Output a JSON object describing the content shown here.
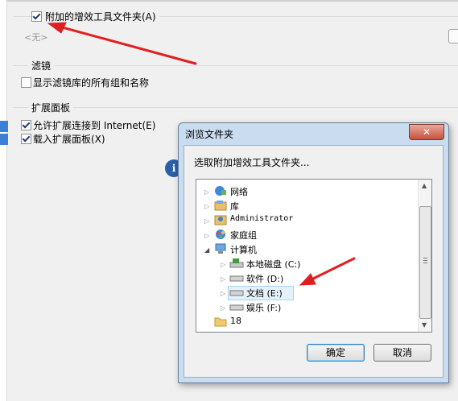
{
  "options": {
    "addin_folder_label": "附加的增效工具文件夹(A)",
    "addin_folder_value": "<无>",
    "filter_header": "滤镜",
    "show_filter_label": "显示滤镜库的所有组和名称",
    "ext_header": "扩展面板",
    "allow_ext_label": "允许扩展连接到 Internet(E)",
    "load_ext_label": "载入扩展面板(X)",
    "info_glyph": "i"
  },
  "dialog": {
    "title": "浏览文件夹",
    "close_glyph": "✕",
    "prompt": "选取附加增效工具文件夹...",
    "ok": "确定",
    "cancel": "取消",
    "tree": [
      {
        "label": "网络",
        "icon": "network-icon"
      },
      {
        "label": "库",
        "icon": "library-icon"
      },
      {
        "label": "Administrator",
        "icon": "user-icon"
      },
      {
        "label": "家庭组",
        "icon": "homegroup-icon"
      },
      {
        "label": "计算机",
        "icon": "computer-icon"
      },
      {
        "label": "本地磁盘 (C:)",
        "icon": "system-drive-icon"
      },
      {
        "label": "软件 (D:)",
        "icon": "drive-icon"
      },
      {
        "label": "文档 (E:)",
        "icon": "drive-icon"
      },
      {
        "label": "娱乐 (F:)",
        "icon": "drive-icon"
      },
      {
        "label": "18",
        "icon": "folder-icon"
      }
    ]
  },
  "annotation_color": "#e02020"
}
